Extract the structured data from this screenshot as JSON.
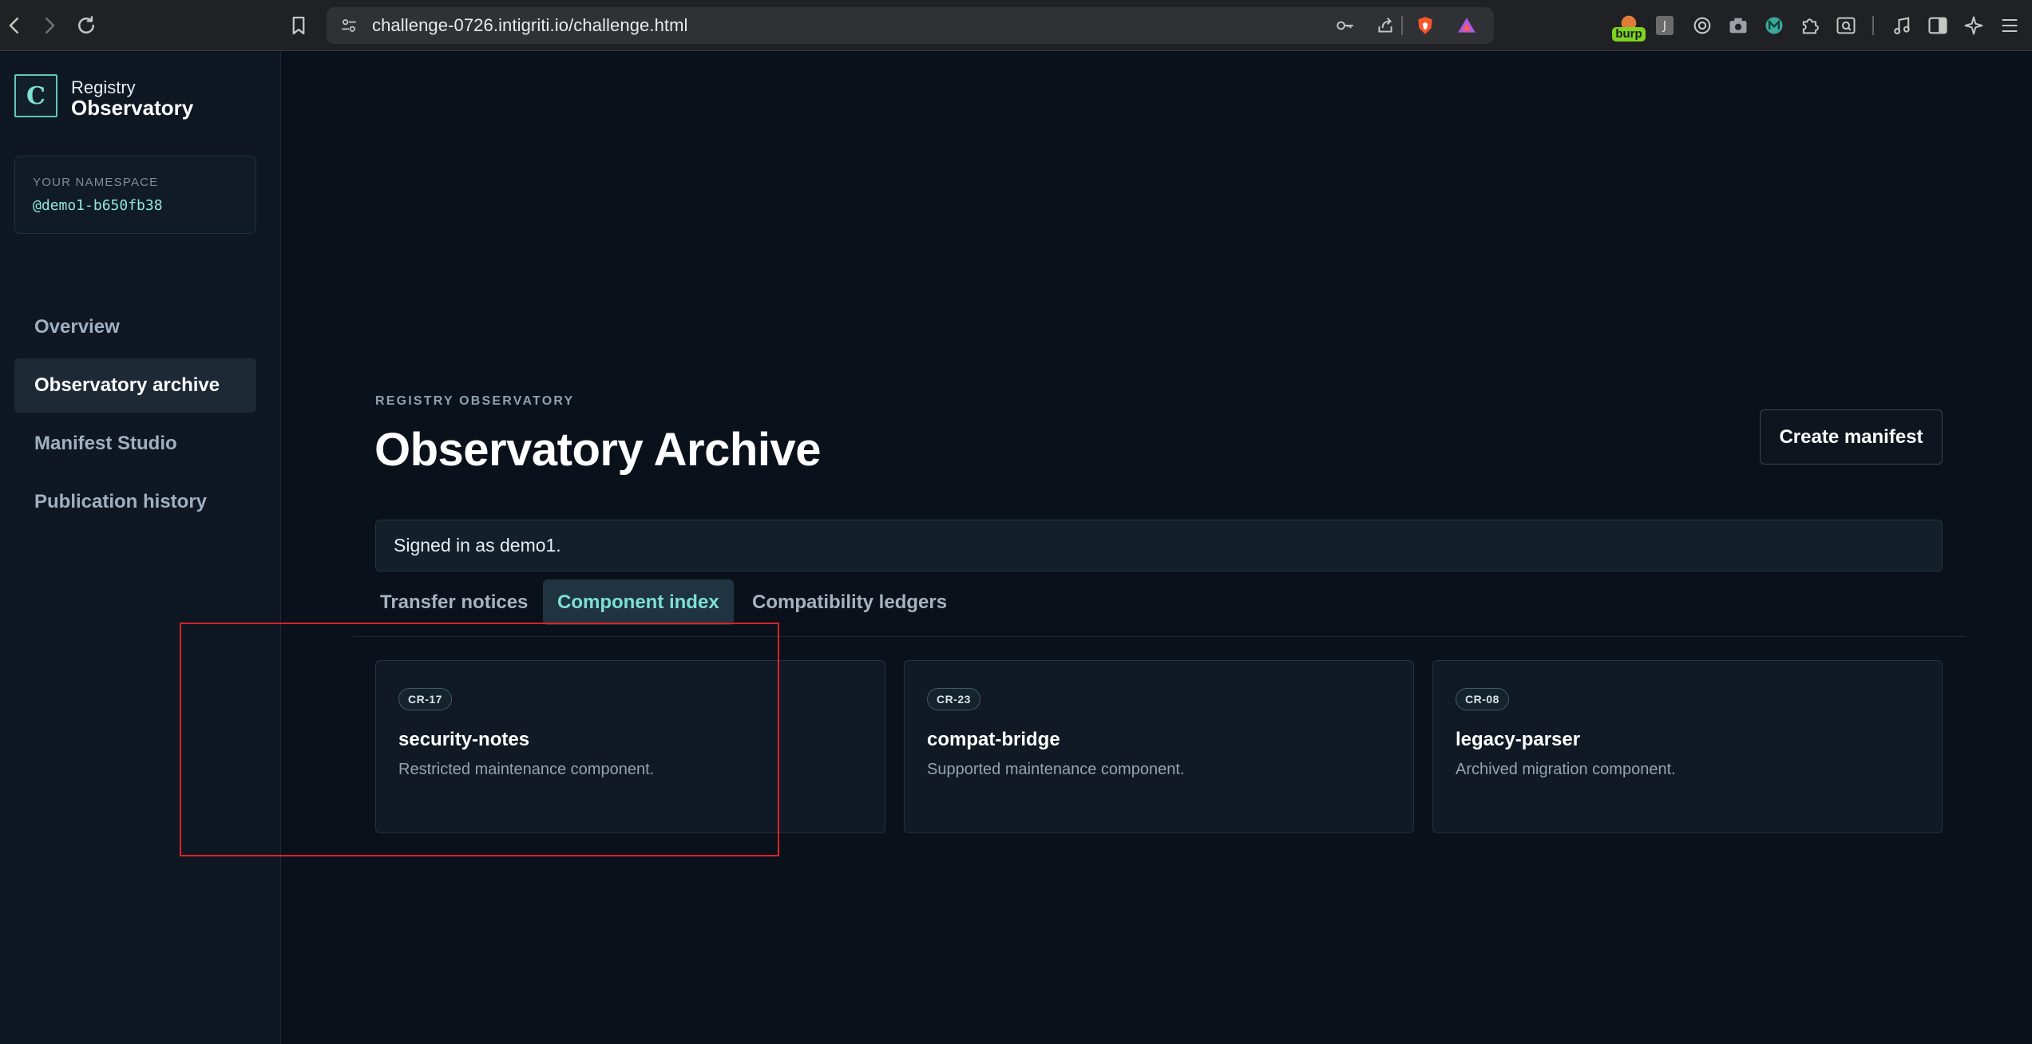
{
  "browser": {
    "url": "challenge-0726.intigriti.io/challenge.html",
    "extensions": {
      "burp_label": "burp",
      "j_label": "J"
    }
  },
  "sidebar": {
    "brand_letter": "C",
    "brand_top": "Registry",
    "brand_main": "Observatory",
    "namespace_label": "YOUR NAMESPACE",
    "namespace_value": "@demo1-b650fb38",
    "items": [
      {
        "label": "Overview"
      },
      {
        "label": "Observatory archive"
      },
      {
        "label": "Manifest Studio"
      },
      {
        "label": "Publication history"
      }
    ]
  },
  "main": {
    "eyebrow": "REGISTRY OBSERVATORY",
    "title": "Observatory Archive",
    "create_button": "Create manifest",
    "status": "Signed in as demo1.",
    "tabs": [
      {
        "label": "Transfer notices"
      },
      {
        "label": "Component index"
      },
      {
        "label": "Compatibility ledgers"
      }
    ],
    "cards": [
      {
        "badge": "CR-17",
        "title": "security-notes",
        "desc": "Restricted maintenance component."
      },
      {
        "badge": "CR-23",
        "title": "compat-bridge",
        "desc": "Supported maintenance component."
      },
      {
        "badge": "CR-08",
        "title": "legacy-parser",
        "desc": "Archived migration component."
      }
    ]
  },
  "colors": {
    "accent": "#7ee0d6",
    "highlight": "#d9232a",
    "background": "#0b111b"
  }
}
